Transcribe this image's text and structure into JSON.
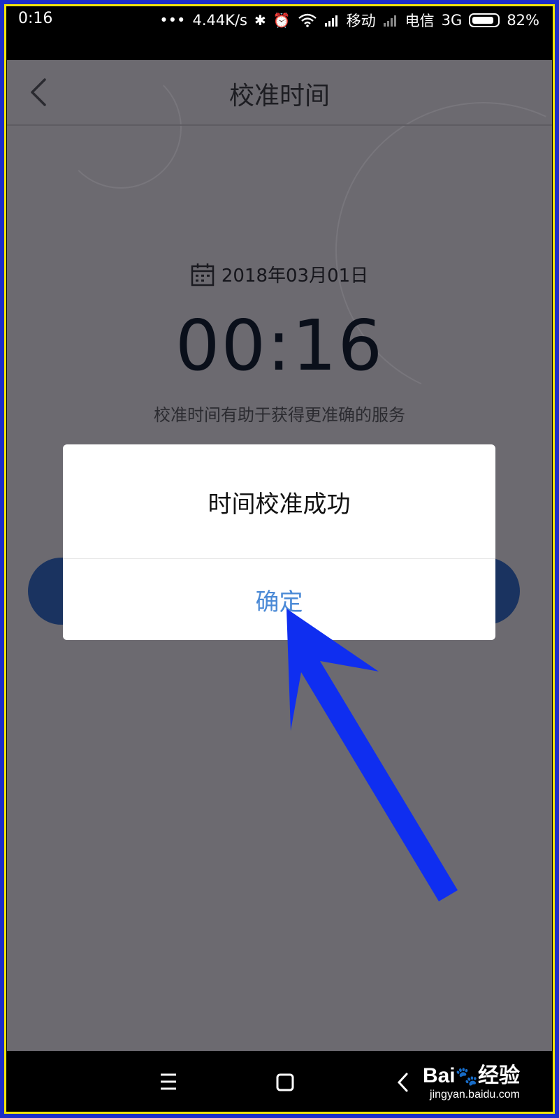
{
  "status_bar": {
    "time": "0:16",
    "dots": "•••",
    "speed": "4.44K/s",
    "carrier1": "移动",
    "carrier2": "电信",
    "network": "3G",
    "battery": "82%"
  },
  "header": {
    "title": "校准时间"
  },
  "main": {
    "date": "2018年03月01日",
    "clock": "00:16",
    "hint": "校准时间有助于获得更准确的服务"
  },
  "dialog": {
    "message": "时间校准成功",
    "ok_label": "确定"
  },
  "watermark": {
    "brand_left": "Bai",
    "brand_right": "经验",
    "url": "jingyan.baidu.com"
  },
  "colors": {
    "overlay": "#6c6a70",
    "accent": "#4b8ad6",
    "annotation_arrow": "#0f2ef0"
  }
}
